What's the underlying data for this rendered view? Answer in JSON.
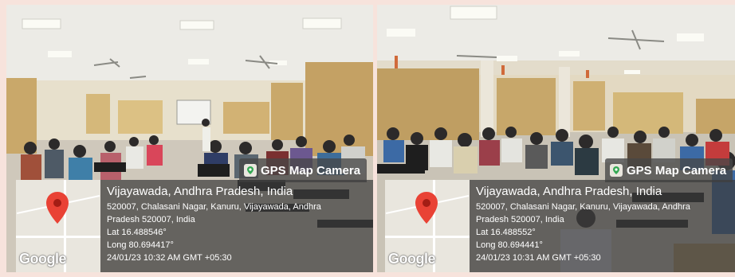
{
  "photos": [
    {
      "badge": "GPS Map Camera",
      "google_logo": "Google",
      "place": "Vijayawada, Andhra Pradesh, India",
      "address_line1": "520007, Chalasani Nagar, Kanuru, Vijayawada, Andhra",
      "address_line2": "Pradesh 520007, India",
      "lat": "Lat 16.488546°",
      "long": "Long 80.694417°",
      "datetime": "24/01/23 10:32 AM GMT +05:30"
    },
    {
      "badge": "GPS Map Camera",
      "google_logo": "Google",
      "place": "Vijayawada, Andhra Pradesh, India",
      "address_line1": "520007, Chalasani Nagar, Kanuru, Vijayawada, Andhra",
      "address_line2": "Pradesh 520007, India",
      "lat": "Lat 16.488552°",
      "long": "Long 80.694441°",
      "datetime": "24/01/23 10:31 AM GMT +05:30"
    }
  ],
  "colors": {
    "background": "#f7e3dc",
    "pin": "#e94235",
    "curtain": "#c9a86a",
    "ceiling": "#ecebe6"
  }
}
